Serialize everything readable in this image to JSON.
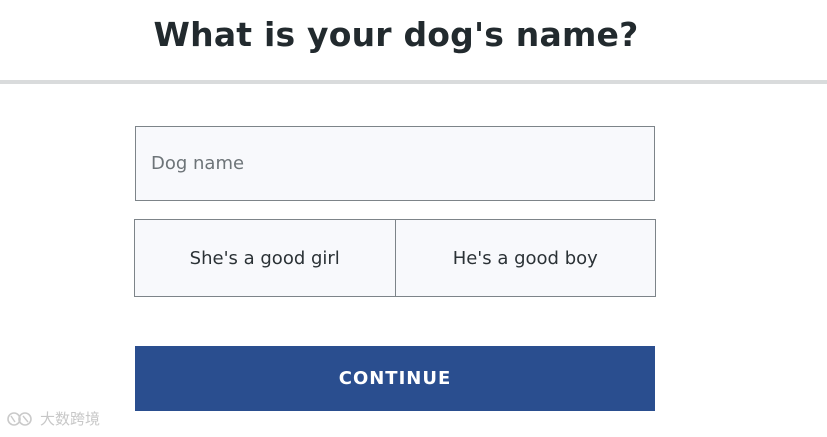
{
  "page": {
    "title": "What is your dog's name?"
  },
  "form": {
    "name_placeholder": "Dog name",
    "gender_options": [
      {
        "label": "She's a good girl"
      },
      {
        "label": "He's a good boy"
      }
    ],
    "continue_label": "CONTINUE"
  },
  "watermark": {
    "text": "大数跨境"
  },
  "colors": {
    "heading": "#222a2e",
    "divider": "#d9dbdc",
    "field_background": "#f8f9fc",
    "field_border": "#7d8489",
    "button_background": "#2a4e8f",
    "button_text": "#ffffff"
  }
}
